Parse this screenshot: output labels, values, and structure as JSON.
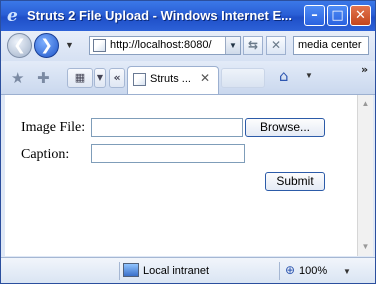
{
  "window": {
    "title": "Struts 2 File Upload - Windows Internet E...",
    "minimize_glyph": "–",
    "maximize_glyph": "□",
    "close_glyph": "✕"
  },
  "navbar": {
    "address_url": "http://localhost:8080/",
    "search_value": "media center",
    "back_glyph": "❮",
    "forward_glyph": "❯",
    "refresh_glyph": "⇆",
    "stop_glyph": "✕"
  },
  "tabs": {
    "active_label": "Struts ...",
    "close_glyph": "✕",
    "quicktabs_glyph": "▦",
    "list_glyph": "«",
    "home_glyph": "⌂",
    "more_glyph": "»"
  },
  "form": {
    "image_file_label": "Image File:",
    "image_file_value": "",
    "browse_label": "Browse...",
    "caption_label": "Caption:",
    "caption_value": "",
    "submit_label": "Submit"
  },
  "statusbar": {
    "zone_text": "Local intranet",
    "zoom_text": "100%"
  },
  "icons": {
    "app": "ie-logo",
    "favorites": "star-icon",
    "add_favorite": "add-favorite-icon",
    "home": "home-icon",
    "zone": "intranet-icon",
    "zoom": "zoom-icon"
  },
  "colors": {
    "titlebar": "#2a5fd6",
    "chrome": "#dfe8f6",
    "button_border": "#2c5ba8"
  }
}
